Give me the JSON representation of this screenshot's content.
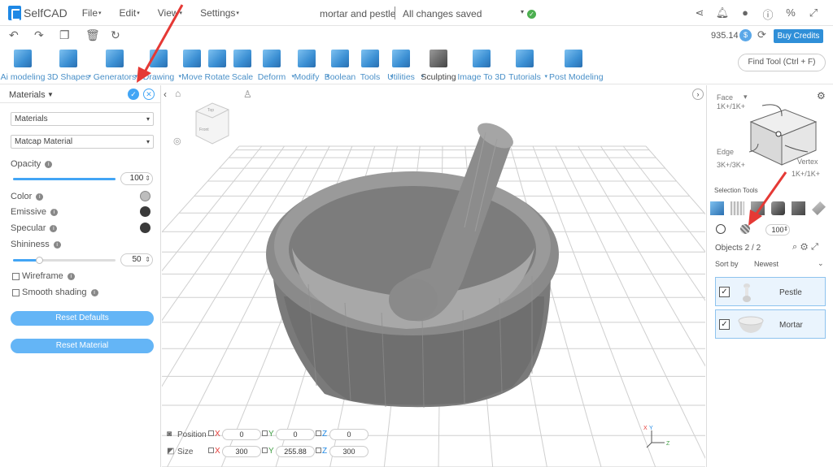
{
  "app": {
    "name": "SelfCAD"
  },
  "menu": [
    "File",
    "Edit",
    "View",
    "Settings"
  ],
  "document": {
    "title": "mortar and pestle",
    "status": "All changes saved"
  },
  "credits": {
    "amount": "935.14",
    "buy_label": "Buy Credits"
  },
  "toolbar": {
    "tools": [
      {
        "label": "Ai modeling",
        "caret": false
      },
      {
        "label": "3D Shapes",
        "caret": true
      },
      {
        "label": "Generators",
        "caret": true
      },
      {
        "label": "Drawing",
        "caret": true
      },
      {
        "label": "Move",
        "caret": false
      },
      {
        "label": "Rotate",
        "caret": false
      },
      {
        "label": "Scale",
        "caret": false
      },
      {
        "label": "Deform",
        "caret": true
      },
      {
        "label": "Modify",
        "caret": true
      },
      {
        "label": "Boolean",
        "caret": false
      },
      {
        "label": "Tools",
        "caret": true
      },
      {
        "label": "Utilities",
        "caret": true
      },
      {
        "label": "Sculpting",
        "caret": false
      },
      {
        "label": "Image To 3D",
        "caret": false
      },
      {
        "label": "Tutorials",
        "caret": true
      },
      {
        "label": "Post Modeling",
        "caret": false
      }
    ],
    "find_tool": "Find Tool (Ctrl + F)"
  },
  "materials_panel": {
    "title": "Materials",
    "select1": "Materials",
    "select2": "Matcap Material",
    "opacity_label": "Opacity",
    "opacity_value": "100",
    "opacity_level": 1.0,
    "color_label": "Color",
    "emissive_label": "Emissive",
    "specular_label": "Specular",
    "shininess_label": "Shininess",
    "shininess_value": "50",
    "shininess_level": 0.25,
    "wireframe_label": "Wireframe",
    "smooth_label": "Smooth shading",
    "reset_defaults": "Reset Defaults",
    "reset_material": "Reset Material",
    "colors": {
      "color": "#bdbdbd",
      "emissive": "#3a3a3a",
      "specular": "#3a3a3a"
    }
  },
  "transform": {
    "position_label": "Position",
    "size_label": "Size",
    "position": {
      "x": "0",
      "y": "0",
      "z": "0"
    },
    "size": {
      "x": "300",
      "y": "255.88",
      "z": "300"
    },
    "axes": {
      "x": "X",
      "y": "Y",
      "z": "Z"
    }
  },
  "selection": {
    "face_label": "Face",
    "face_count": "1K+/1K+",
    "edge_label": "Edge",
    "edge_count": "3K+/3K+",
    "vertex_label": "Vertex",
    "vertex_count": "1K+/1K+",
    "tools_label": "Selection Tools",
    "value": "100",
    "objects_label": "Objects 2 / 2",
    "sort_label": "Sort by",
    "sort_value": "Newest",
    "objects": [
      {
        "name": "Pestle",
        "checked": "✓"
      },
      {
        "name": "Mortar",
        "checked": "✓"
      }
    ]
  },
  "viewcube": {
    "top_label": "Top",
    "front_label": "Front"
  },
  "colors": {
    "accent": "#2f8fd8",
    "tool_label": "#4a90c8",
    "arrow": "#e53935"
  }
}
